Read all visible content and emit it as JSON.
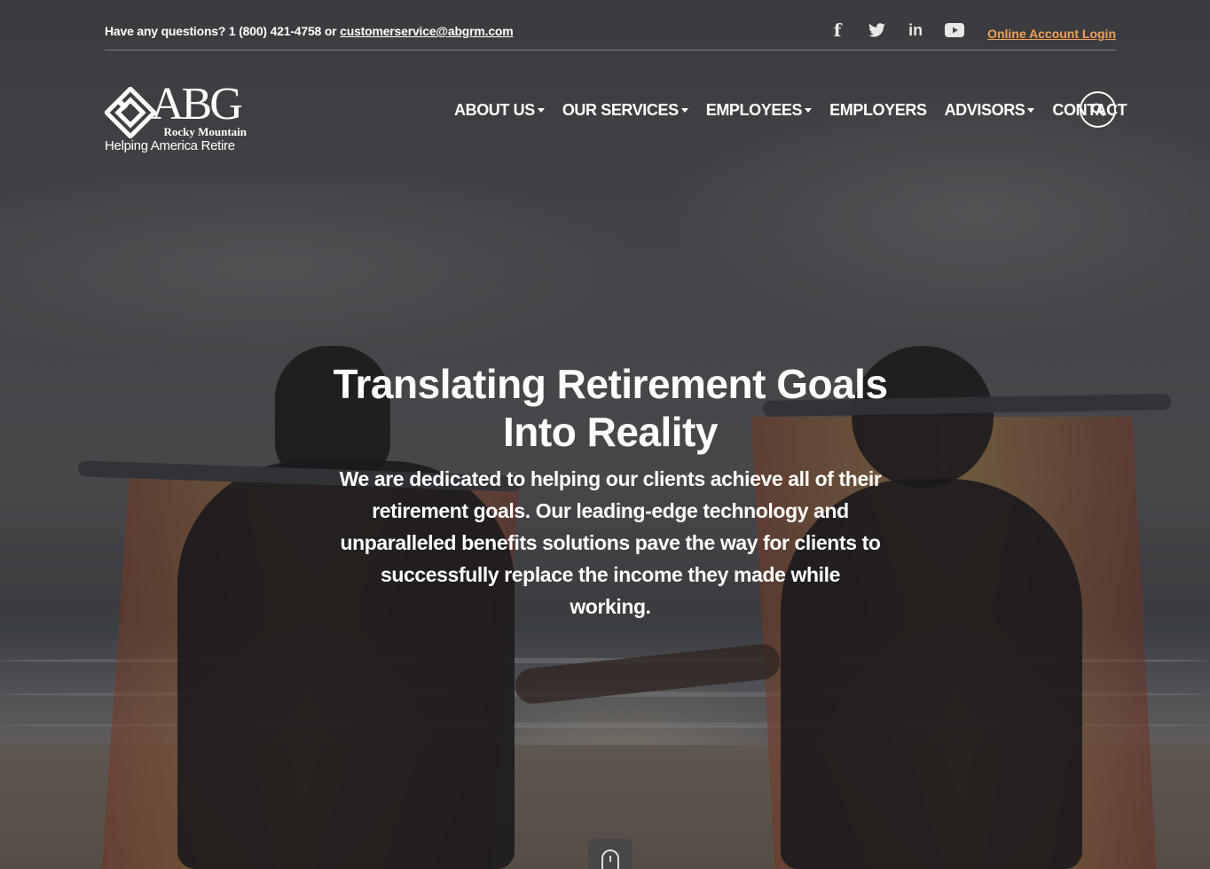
{
  "topbar": {
    "questions_text": "Have any questions? 1 (800) 421-4758 or ",
    "email": "customerservice@abgrm.com",
    "social": [
      {
        "icon": "facebook-icon"
      },
      {
        "icon": "twitter-icon"
      },
      {
        "icon": "linkedin-icon"
      },
      {
        "icon": "youtube-icon"
      }
    ],
    "login_label": "Online Account Login"
  },
  "logo": {
    "name": "ABG",
    "subtitle": "Rocky Mountain",
    "tagline": "Helping America Retire"
  },
  "nav": {
    "items": [
      {
        "label": "ABOUT US",
        "dropdown": true
      },
      {
        "label": "OUR SERVICES",
        "dropdown": true
      },
      {
        "label": "EMPLOYEES",
        "dropdown": true
      },
      {
        "label": "EMPLOYERS",
        "dropdown": false
      },
      {
        "label": "ADVISORS",
        "dropdown": true
      },
      {
        "label": "CONTACT",
        "dropdown": false
      }
    ],
    "search_icon": "search-icon"
  },
  "hero": {
    "title_line1": "Translating Retirement Goals",
    "title_line2": "Into Reality",
    "body": "We are dedicated to helping our clients achieve all of their retirement goals. Our leading-edge technology and unparalleled benefits solutions pave the way for clients to successfully replace the income they made while working."
  },
  "colors": {
    "accent_link": "#f0a050",
    "text": "#ffffff"
  }
}
